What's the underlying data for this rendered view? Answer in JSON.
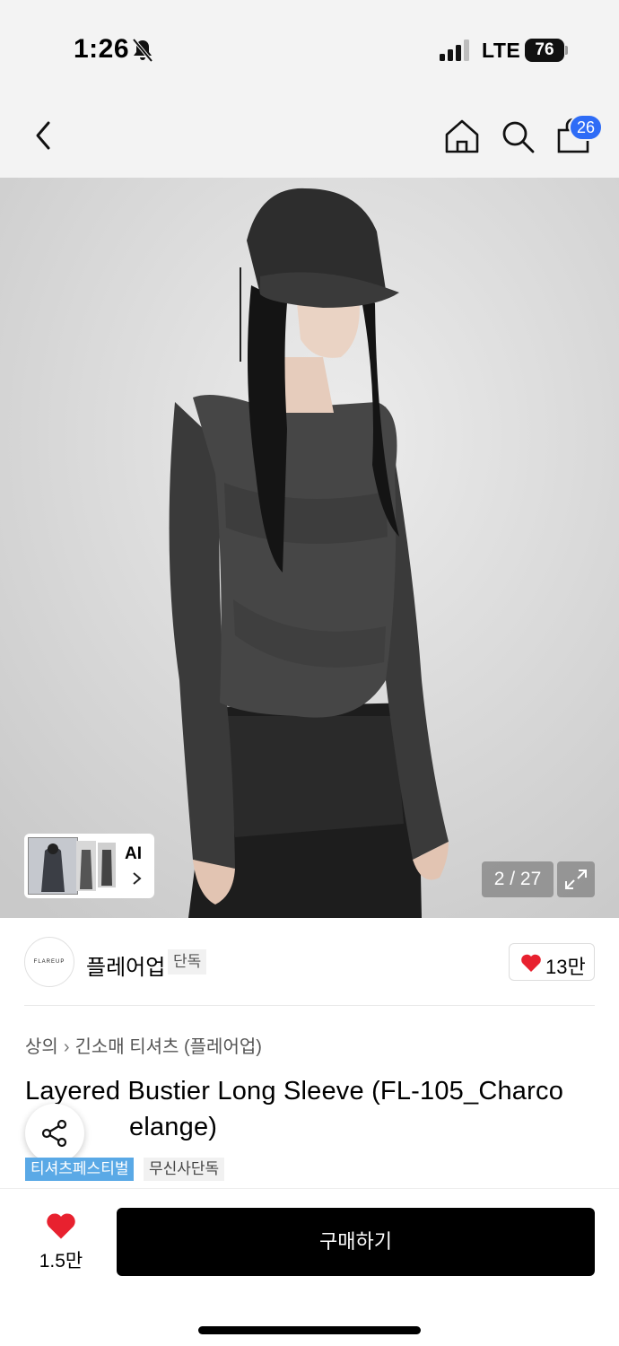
{
  "status_bar": {
    "time": "1:26",
    "network": "LTE",
    "battery": "76"
  },
  "header": {
    "back_icon": "chevron-left-icon",
    "home_icon": "home-icon",
    "search_icon": "search-icon",
    "cart_icon": "shopping-bag-icon",
    "cart_count": "26"
  },
  "gallery": {
    "ai_label": "AI",
    "counter": "2 / 27",
    "expand_icon": "expand-icon"
  },
  "brand": {
    "logo_text": "FLAREUP",
    "name": "플레어업",
    "tag": "단독",
    "likes": "13만"
  },
  "product": {
    "breadcrumb": [
      "상의",
      "긴소매 티셔츠 (플레어업)"
    ],
    "title_line1": "Layered Bustier Long Sleeve (FL-105_Charco",
    "title_line2": "elange)",
    "tags": [
      "티셔츠페스티벌",
      "무신사단독"
    ]
  },
  "bottom_bar": {
    "wish_count": "1.5만",
    "buy_label": "구매하기"
  },
  "colors": {
    "badge": "#2e6cf6",
    "heart": "#e8212f",
    "festival_tag": "#5aa9e6",
    "buy_button": "#000000"
  }
}
